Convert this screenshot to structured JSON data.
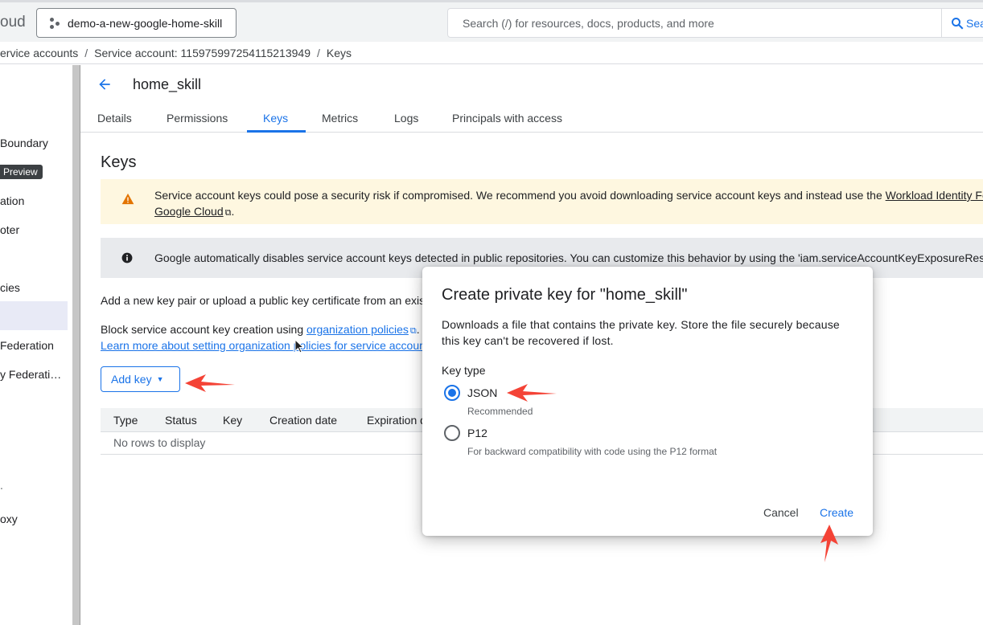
{
  "topbar": {
    "brand_fragment": "oud",
    "project_name": "demo-a-new-google-home-skill",
    "search_placeholder": "Search (/) for resources, docs, products, and more",
    "search_button": "Sea"
  },
  "breadcrumb": {
    "items": [
      "ervice accounts",
      "Service account: 115975997254115213949",
      "Keys"
    ]
  },
  "sidebar": {
    "items": [
      {
        "label": "Boundary"
      },
      {
        "label": "Preview"
      },
      {
        "label": "ation"
      },
      {
        "label": "oter"
      },
      {
        "label": "cies"
      },
      {
        "label": "Federation"
      },
      {
        "label": "y Federati…"
      },
      {
        "label": "."
      },
      {
        "label": "oxy"
      }
    ]
  },
  "header": {
    "title": "home_skill"
  },
  "tabs": [
    {
      "label": "Details"
    },
    {
      "label": "Permissions"
    },
    {
      "label": "Keys"
    },
    {
      "label": "Metrics"
    },
    {
      "label": "Logs"
    },
    {
      "label": "Principals with access"
    }
  ],
  "main": {
    "section_title": "Keys",
    "warning": {
      "text": "Service account keys could pose a security risk if compromised. We recommend you avoid downloading service account keys and instead use the ",
      "link": "Workload Identity Fed",
      "line2_link": "Google Cloud",
      "line2_end": "."
    },
    "info": {
      "text": "Google automatically disables service account keys detected in public repositories. You can customize this behavior by using the 'iam.serviceAccountKeyExposureRespo"
    },
    "para1": "Add a new key pair or upload a public key certificate from an exist",
    "para2_text": "Block service account key creation using ",
    "para2_link": "organization policies",
    "para2_end": ".",
    "para3_link": "Learn more about setting organization policies for service accour",
    "add_key_label": "Add key",
    "table": {
      "columns": [
        "Type",
        "Status",
        "Key",
        "Creation date",
        "Expiration d"
      ],
      "empty": "No rows to display"
    }
  },
  "modal": {
    "title": "Create private key for \"home_skill\"",
    "description": "Downloads a file that contains the private key. Store the file securely because this key can't be recovered if lost.",
    "key_type_label": "Key type",
    "options": [
      {
        "label": "JSON",
        "hint": "Recommended",
        "selected": true
      },
      {
        "label": "P12",
        "hint": "For backward compatibility with code using the P12 format",
        "selected": false
      }
    ],
    "cancel_label": "Cancel",
    "create_label": "Create"
  },
  "colors": {
    "accent": "#1a73e8",
    "warning_bg": "#fef7e0",
    "warning_icon": "#e37400",
    "annotation_arrow": "#f44336"
  }
}
